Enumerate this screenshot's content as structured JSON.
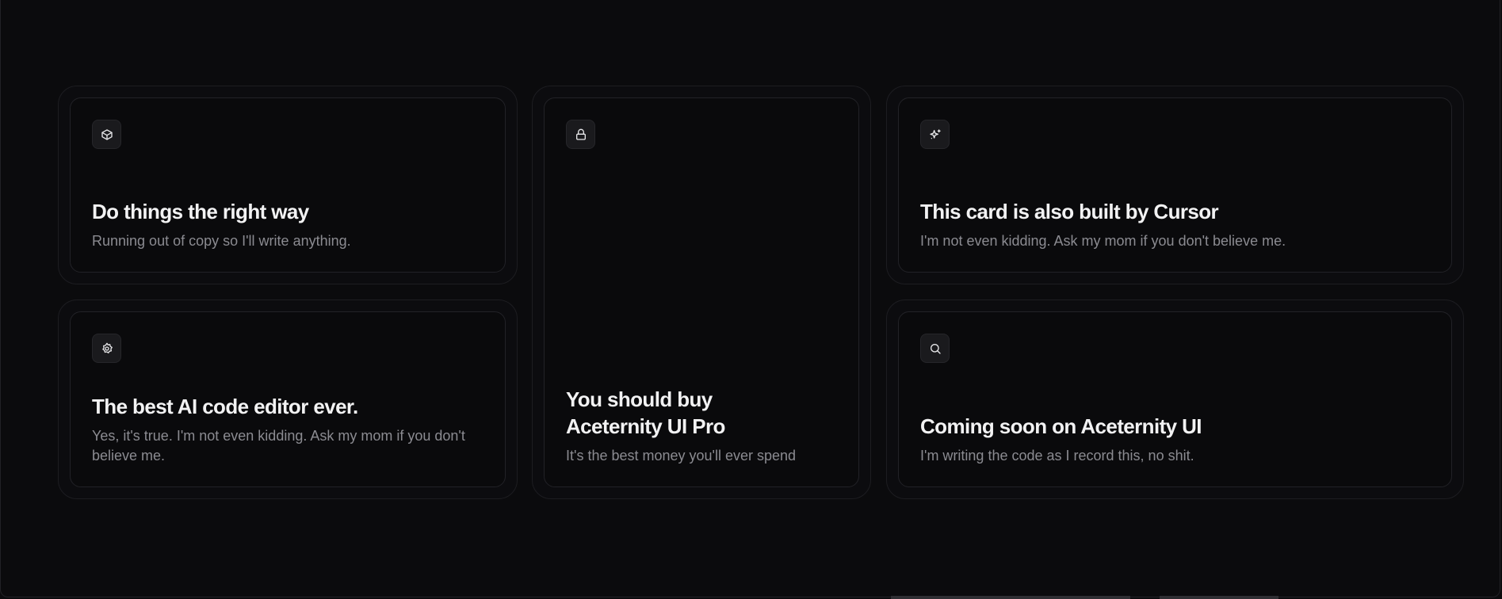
{
  "cards": [
    {
      "icon": "box-icon",
      "title": "Do things the right way",
      "description": "Running out of copy so I'll write anything."
    },
    {
      "icon": "settings-icon",
      "title": "The best AI code editor ever.",
      "description": "Yes, it's true. I'm not even kidding. Ask my mom if you don't believe me."
    },
    {
      "icon": "lock-icon",
      "title": "You should buy Aceternity UI Pro",
      "description": "It's the best money you'll ever spend"
    },
    {
      "icon": "sparkles-icon",
      "title": "This card is also built by Cursor",
      "description": "I'm not even kidding. Ask my mom if you don't believe me."
    },
    {
      "icon": "search-icon",
      "title": "Coming soon on Aceternity UI",
      "description": "I'm writing the code as I record this, no shit."
    }
  ]
}
